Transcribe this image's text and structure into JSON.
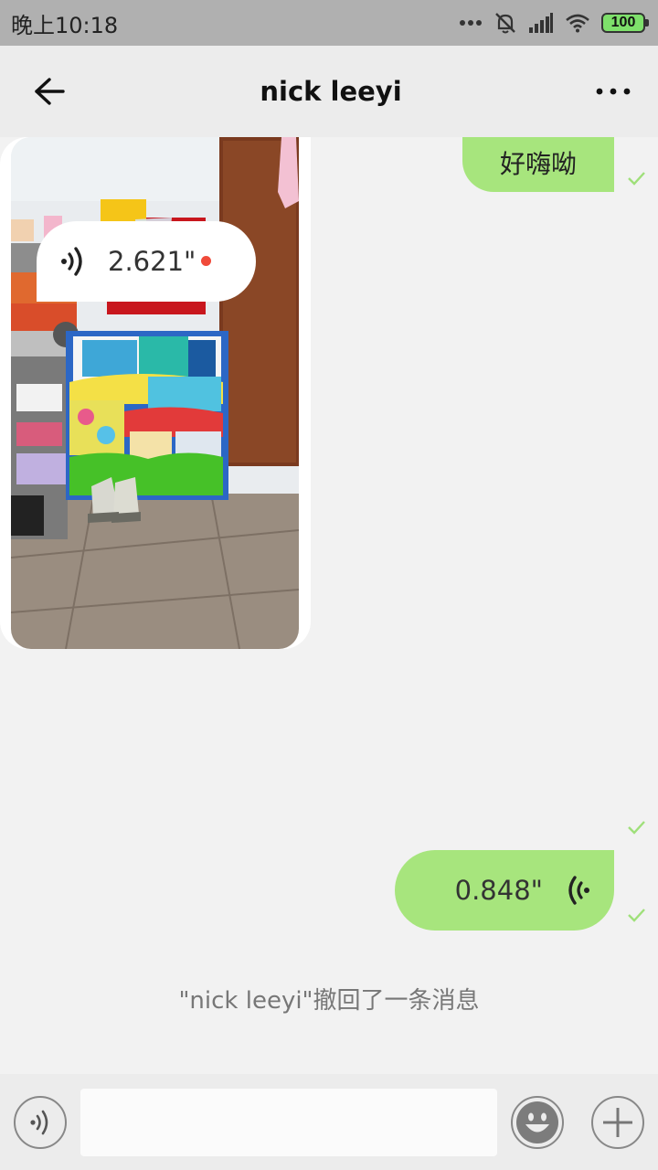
{
  "status_bar": {
    "time": "晚上10:18",
    "battery": "100",
    "icons": [
      "more-dots-icon",
      "mute-bell-icon",
      "signal-icon",
      "wifi-icon",
      "battery-icon"
    ]
  },
  "header": {
    "title": "nick leeyi",
    "back_icon": "back-arrow-icon",
    "more_icon": "more-horizontal-icon"
  },
  "messages": [
    {
      "direction": "out",
      "type": "text",
      "text": "好嗨呦",
      "status": "sent"
    },
    {
      "direction": "in",
      "type": "voice",
      "duration": "2.621\"",
      "unread": true
    },
    {
      "direction": "out",
      "type": "image",
      "status": "sent"
    },
    {
      "direction": "out",
      "type": "voice",
      "duration": "0.848\"",
      "status": "sent"
    }
  ],
  "system_notice": "\"nick leeyi\"撤回了一条消息",
  "input_bar": {
    "voice_icon": "voice-toggle-icon",
    "text_value": "",
    "emoji_icon": "emoji-icon",
    "add_icon": "plus-icon"
  },
  "colors": {
    "outgoing_bubble": "#a7e57d",
    "incoming_bubble": "#ffffff",
    "unread_dot": "#f04a3a",
    "check": "#9fe07a"
  }
}
